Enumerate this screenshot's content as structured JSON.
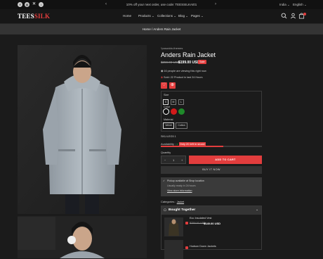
{
  "announcement": {
    "social_icons": [
      "facebook-icon",
      "instagram-icon",
      "x-icon",
      "tiktok-icon"
    ],
    "message": "10% off your next order, use code: TEESSILKAI01",
    "locale": "India",
    "language": "English"
  },
  "header": {
    "logo_main": "TEES",
    "logo_accent": "SILK",
    "nav": [
      "Home",
      "Products",
      "Collections",
      "Blog",
      "Pages"
    ],
    "cart_count": "0"
  },
  "breadcrumb": {
    "home": "Home",
    "separator": "/",
    "current": "Anders Rain Jacket"
  },
  "product": {
    "vendor": "*posoddo-themes",
    "title": "Anders Rain Jacket",
    "compare_price": "$259.00 USD",
    "price": "$199.00 USD",
    "sale_badge": "Sale",
    "viewing_text": "16 people are viewing this right now",
    "sold_text": "Sold: 22 Product in last 24 Hours",
    "size_label": "Size",
    "sizes": [
      "S",
      "M",
      "L"
    ],
    "color_label": "Color",
    "material_label": "Material",
    "materials": [
      "Velvet",
      "Cotton"
    ],
    "sku": "SKU:LEG5 1",
    "availability_label": "Availability :",
    "availability_value": "Only 20 left in stock!",
    "stock_fraction": 0.62,
    "quantity_label": "Quantity",
    "quantity": "1",
    "add_to_cart": "ADD TO CART",
    "buy_now": "BUY IT NOW",
    "pickup_available": "Pickup available at Shop location",
    "pickup_ready": "Usually ready in 24 hours",
    "pickup_link": "View store information",
    "categories_label": "Categories :",
    "category": "Jacket"
  },
  "bought_together": {
    "title": "Bought Together",
    "items": [
      {
        "name": "Eco Insulated Vest",
        "old_price": "$259.00 USD",
        "price": "$149.00 USD"
      },
      {
        "name": "Hudson Down Jackets",
        "old_price": "",
        "price": ""
      }
    ]
  },
  "colors": {
    "accent": "#e23d3d",
    "swatch_black": "#111111",
    "swatch_red": "#d11a1a",
    "swatch_green": "#1f8a2a"
  }
}
